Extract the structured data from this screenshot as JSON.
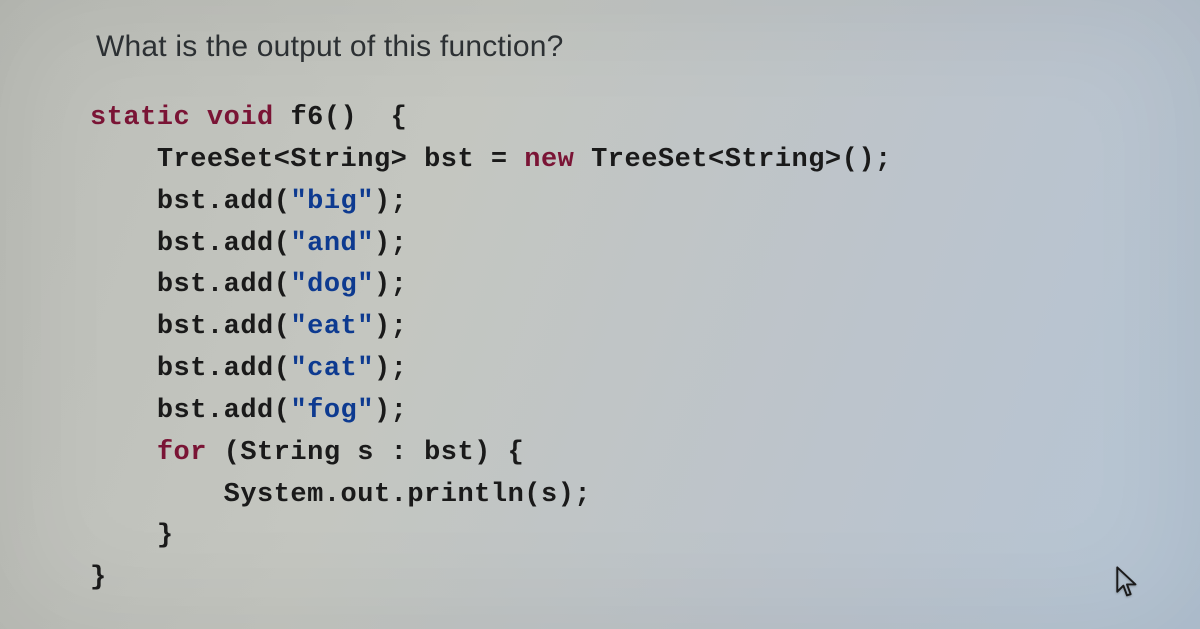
{
  "question": "What is the output of this function?",
  "code": {
    "tokens": [
      [
        {
          "c": "kw",
          "t": "static"
        },
        {
          "c": "sp",
          "t": " "
        },
        {
          "c": "kw",
          "t": "void"
        },
        {
          "c": "sp",
          "t": " "
        },
        {
          "c": "ident",
          "t": "f6"
        },
        {
          "c": "punct",
          "t": "()"
        },
        {
          "c": "sp",
          "t": "  "
        },
        {
          "c": "punct",
          "t": "{"
        }
      ],
      [
        {
          "c": "indent",
          "t": "    "
        },
        {
          "c": "type",
          "t": "TreeSet<String>"
        },
        {
          "c": "sp",
          "t": " "
        },
        {
          "c": "ident",
          "t": "bst"
        },
        {
          "c": "sp",
          "t": " "
        },
        {
          "c": "op",
          "t": "="
        },
        {
          "c": "sp",
          "t": " "
        },
        {
          "c": "kw",
          "t": "new"
        },
        {
          "c": "sp",
          "t": " "
        },
        {
          "c": "type",
          "t": "TreeSet<String>"
        },
        {
          "c": "punct",
          "t": "();"
        }
      ],
      [
        {
          "c": "indent",
          "t": "    "
        },
        {
          "c": "ident",
          "t": "bst.add"
        },
        {
          "c": "punct",
          "t": "("
        },
        {
          "c": "str",
          "t": "\"big\""
        },
        {
          "c": "punct",
          "t": ");"
        }
      ],
      [
        {
          "c": "indent",
          "t": "    "
        },
        {
          "c": "ident",
          "t": "bst.add"
        },
        {
          "c": "punct",
          "t": "("
        },
        {
          "c": "str",
          "t": "\"and\""
        },
        {
          "c": "punct",
          "t": ");"
        }
      ],
      [
        {
          "c": "indent",
          "t": "    "
        },
        {
          "c": "ident",
          "t": "bst.add"
        },
        {
          "c": "punct",
          "t": "("
        },
        {
          "c": "str",
          "t": "\"dog\""
        },
        {
          "c": "punct",
          "t": ");"
        }
      ],
      [
        {
          "c": "indent",
          "t": "    "
        },
        {
          "c": "ident",
          "t": "bst.add"
        },
        {
          "c": "punct",
          "t": "("
        },
        {
          "c": "str",
          "t": "\"eat\""
        },
        {
          "c": "punct",
          "t": ");"
        }
      ],
      [
        {
          "c": "indent",
          "t": "    "
        },
        {
          "c": "ident",
          "t": "bst.add"
        },
        {
          "c": "punct",
          "t": "("
        },
        {
          "c": "str",
          "t": "\"cat\""
        },
        {
          "c": "punct",
          "t": ");"
        }
      ],
      [
        {
          "c": "indent",
          "t": "    "
        },
        {
          "c": "ident",
          "t": "bst.add"
        },
        {
          "c": "punct",
          "t": "("
        },
        {
          "c": "str",
          "t": "\"fog\""
        },
        {
          "c": "punct",
          "t": ");"
        }
      ],
      [
        {
          "c": "indent",
          "t": "    "
        },
        {
          "c": "kw",
          "t": "for"
        },
        {
          "c": "sp",
          "t": " "
        },
        {
          "c": "punct",
          "t": "("
        },
        {
          "c": "type",
          "t": "String"
        },
        {
          "c": "sp",
          "t": " "
        },
        {
          "c": "ident",
          "t": "s"
        },
        {
          "c": "sp",
          "t": " "
        },
        {
          "c": "punct",
          "t": ":"
        },
        {
          "c": "sp",
          "t": " "
        },
        {
          "c": "ident",
          "t": "bst"
        },
        {
          "c": "punct",
          "t": ")"
        },
        {
          "c": "sp",
          "t": " "
        },
        {
          "c": "punct",
          "t": "{"
        }
      ],
      [
        {
          "c": "indent",
          "t": "        "
        },
        {
          "c": "ident",
          "t": "System.out.println"
        },
        {
          "c": "punct",
          "t": "("
        },
        {
          "c": "ident",
          "t": "s"
        },
        {
          "c": "punct",
          "t": ");"
        }
      ],
      [
        {
          "c": "indent",
          "t": "    "
        },
        {
          "c": "punct",
          "t": "}"
        }
      ],
      [
        {
          "c": "punct",
          "t": "}"
        }
      ]
    ]
  }
}
